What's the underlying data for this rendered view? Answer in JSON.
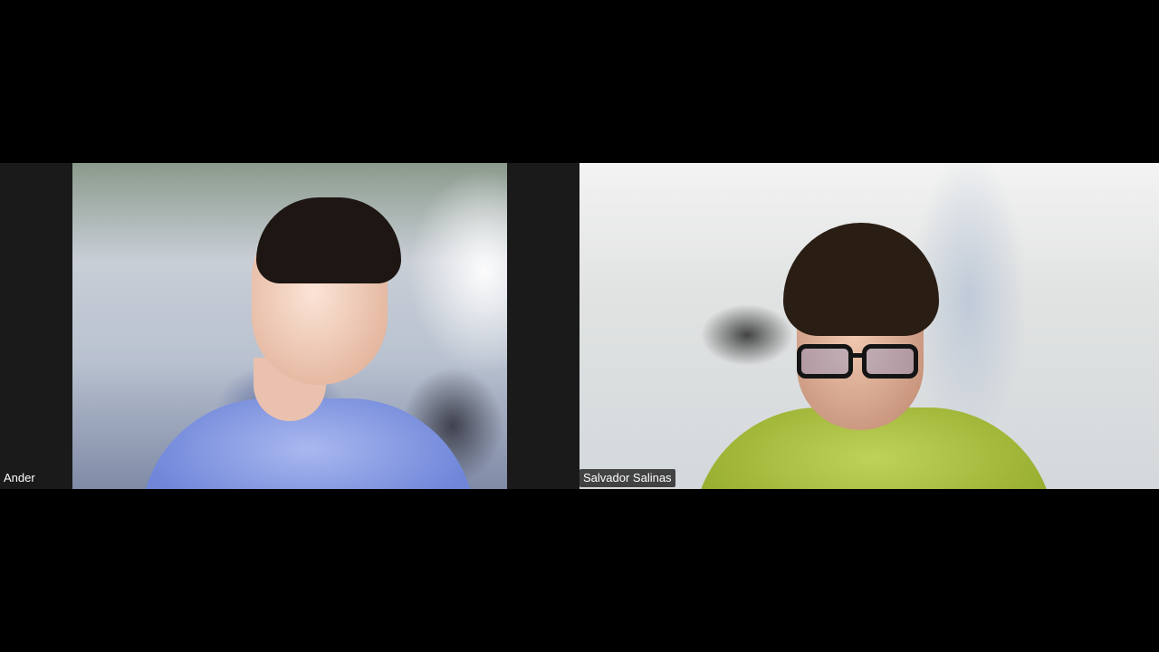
{
  "participants": [
    {
      "name": "Ander"
    },
    {
      "name": "Salvador Salinas"
    }
  ],
  "colors": {
    "background": "#000000",
    "tile_letterbox": "#1a1a1a",
    "name_label_text": "#ffffff"
  }
}
